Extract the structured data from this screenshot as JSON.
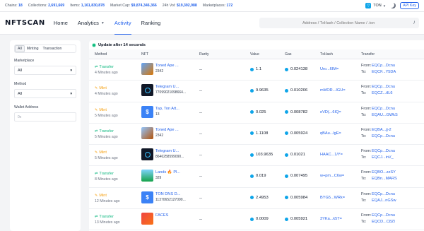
{
  "stats": {
    "chains_label": "Chains:",
    "chains": "18",
    "collections_label": "Collections:",
    "collections": "2,691,669",
    "items_label": "Items:",
    "items": "1,161,830,878",
    "marketcap_label": "Market Cap:",
    "marketcap": "$9,874,346,366",
    "vol24_label": "24h Vol:",
    "vol24": "$19,392,988",
    "marketplaces_label": "Marketplaces:",
    "marketplaces": "172",
    "chain_selector": "TON",
    "api_key": "API Key"
  },
  "nav": {
    "logo": "NFTSCAN",
    "home": "Home",
    "analytics": "Analytics",
    "activity": "Activity",
    "ranking": "Ranking",
    "search_placeholder": "Address / TxHash / Collection Name / .ton",
    "search_shortcut": "/"
  },
  "filters": {
    "tabs": [
      "All",
      "Minting",
      "Transaction"
    ],
    "marketplace_label": "Marketplace",
    "marketplace_value": "All",
    "method_label": "Method",
    "method_value": "All",
    "wallet_label": "Wallet Address",
    "wallet_placeholder": "0x"
  },
  "table": {
    "update_text": "Update after 14 seconds",
    "headers": {
      "method": "Method",
      "nft": "NFT",
      "rarity": "Rarity",
      "value": "Value",
      "gas": "Gas",
      "txhash": "TxHash",
      "transfer": "Transfer"
    },
    "from_label": "From:",
    "to_label": "To:",
    "rows": [
      {
        "method": "Transfer",
        "time": "4 Minutes ago",
        "nft_name": "Toned Ape ...",
        "nft_id": "2342",
        "rarity": "--",
        "value": "1.1",
        "gas": "0.024138",
        "txhash": "Uro...6IM=",
        "from": "EQCp...Dcnu",
        "to": "EQCF...Y5DA"
      },
      {
        "method": "Mint",
        "time": "4 Minutes ago",
        "nft_name": "Telegram U...",
        "nft_id": "77099021098664...",
        "rarity": "--",
        "value": "9.9635",
        "gas": "0.010206",
        "txhash": "mMOR...IGU=",
        "from": "EQCp...Dcnu",
        "to": "EQCZ...tIL6"
      },
      {
        "method": "Mint",
        "time": "5 Minutes ago",
        "nft_name": "Tap, Ton Att...",
        "nft_id": "13",
        "rarity": "--",
        "value": "0.025",
        "gas": "0.008782",
        "txhash": "eVD(...6IQ=",
        "from": "EQCp...Dcnu",
        "to": "EQAU...GWkS"
      },
      {
        "method": "Transfer",
        "time": "5 Minutes ago",
        "nft_name": "Toned Ape ...",
        "nft_id": "2342",
        "rarity": "--",
        "value": "1.1108",
        "gas": "0.005924",
        "txhash": "qBAu...lgE=",
        "from": "EQBA...jj-2",
        "to": "EQCp...Dcnu"
      },
      {
        "method": "Mint",
        "time": "5 Minutes ago",
        "nft_name": "Telegram U...",
        "nft_id": "8646258599090...",
        "rarity": "--",
        "value": "103.9635",
        "gas": "0.01021",
        "txhash": "HAAC...1/Y=",
        "from": "EQCp...Dcnu",
        "to": "EQCJ...inV_"
      },
      {
        "method": "Transfer",
        "time": "8 Minutes ago",
        "nft_name": "Lands 🔥 Pl...",
        "nft_id": "329",
        "rarity": "--",
        "value": "0.019",
        "gas": "0.007495",
        "txhash": "w+pm...C6w=",
        "from": "EQBO...zzSY",
        "to": "EQBn...MARS"
      },
      {
        "method": "Mint",
        "time": "12 Minutes ago",
        "nft_name": "TON DNS D...",
        "nft_id": "11370652127090...",
        "rarity": "--",
        "value": "2.4953",
        "gas": "0.005984",
        "txhash": "BYG5...WRk=",
        "from": "EQCp...Dcnu",
        "to": "EQAJ...nGSw"
      },
      {
        "method": "Transfer",
        "time": "13 Minutes ago",
        "nft_name": "FACES",
        "nft_id": "",
        "rarity": "--",
        "value": "0.0009",
        "gas": "0.005921",
        "txhash": "3YKa...k5T=",
        "from": "EQCp...Dcnu",
        "to": "EQCD...C8ZI"
      }
    ]
  },
  "colors": {
    "accent": "#2563eb",
    "transfer": "#10b981",
    "mint": "#f59e0b",
    "ton": "#0ea5e9"
  }
}
